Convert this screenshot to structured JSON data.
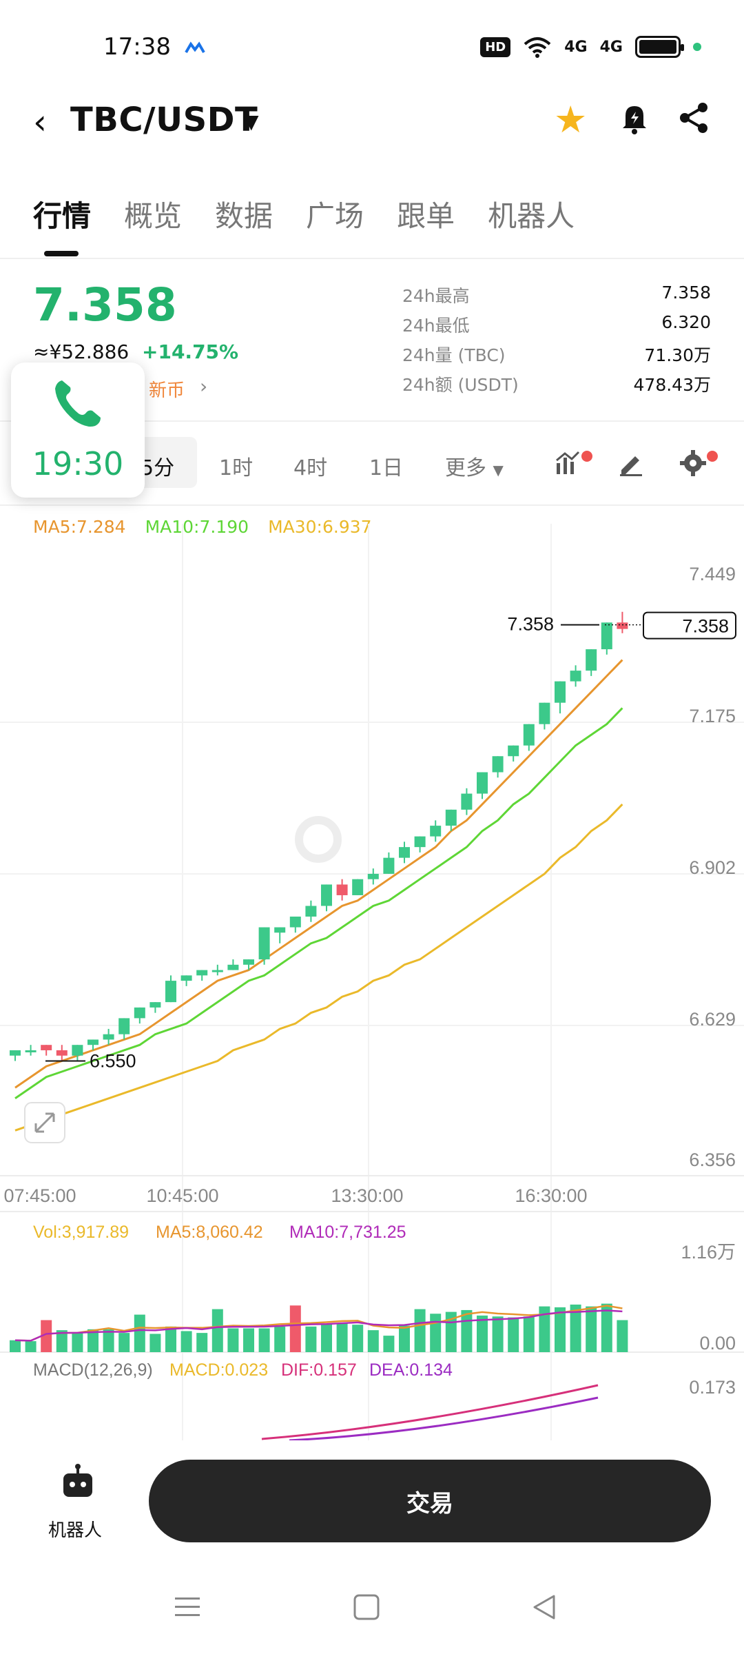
{
  "status_bar": {
    "time": "17:38",
    "hd": "HD",
    "signal_1": "4G",
    "signal_2": "4G"
  },
  "header": {
    "pair": "TBC/USDT"
  },
  "tabs": [
    "行情",
    "概览",
    "数据",
    "广场",
    "跟单",
    "机器人"
  ],
  "ticker": {
    "price": "7.358",
    "cny": "≈¥52.886",
    "change": "+14.75%",
    "tag": "新币",
    "stats": [
      {
        "label": "24h最高",
        "value": "7.358"
      },
      {
        "label": "24h最低",
        "value": "6.320"
      },
      {
        "label": "24h量 (TBC)",
        "value": "71.30万"
      },
      {
        "label": "24h额 (USDT)",
        "value": "478.43万"
      }
    ]
  },
  "call_overlay": {
    "time": "19:30"
  },
  "intervals": [
    "5分",
    "1时",
    "4时",
    "1日",
    "更多"
  ],
  "ma": {
    "ma5": "MA5:7.284",
    "ma10": "MA10:7.190",
    "ma30": "MA30:6.937"
  },
  "colors": {
    "up": "#23b26d",
    "candle_up": "#3cc98a",
    "candle_down": "#ef5a6a",
    "ma5": "#e7952e",
    "ma10": "#5ed636",
    "ma30": "#eab92a",
    "accent_star": "#f6b51e"
  },
  "chart_data": {
    "type": "candlestick",
    "price_axis_ticks": [
      "7.449",
      "7.175",
      "6.902",
      "6.629",
      "6.356"
    ],
    "ylim": [
      6.356,
      7.449
    ],
    "time_axis_ticks": [
      "07:45:00",
      "10:45:00",
      "13:30:00",
      "16:30:00"
    ],
    "last_price_label": "7.358",
    "last_price_tag": "7.358",
    "low_marker": "6.550",
    "candles": [
      {
        "o": 6.56,
        "h": 6.57,
        "l": 6.55,
        "c": 6.57
      },
      {
        "o": 6.57,
        "h": 6.58,
        "l": 6.56,
        "c": 6.57
      },
      {
        "o": 6.58,
        "h": 6.58,
        "l": 6.56,
        "c": 6.57
      },
      {
        "o": 6.57,
        "h": 6.58,
        "l": 6.55,
        "c": 6.56
      },
      {
        "o": 6.56,
        "h": 6.58,
        "l": 6.55,
        "c": 6.58
      },
      {
        "o": 6.58,
        "h": 6.59,
        "l": 6.57,
        "c": 6.59
      },
      {
        "o": 6.59,
        "h": 6.61,
        "l": 6.58,
        "c": 6.6
      },
      {
        "o": 6.6,
        "h": 6.63,
        "l": 6.59,
        "c": 6.63
      },
      {
        "o": 6.63,
        "h": 6.65,
        "l": 6.62,
        "c": 6.65
      },
      {
        "o": 6.65,
        "h": 6.66,
        "l": 6.64,
        "c": 6.66
      },
      {
        "o": 6.66,
        "h": 6.71,
        "l": 6.66,
        "c": 6.7
      },
      {
        "o": 6.7,
        "h": 6.71,
        "l": 6.69,
        "c": 6.71
      },
      {
        "o": 6.71,
        "h": 6.72,
        "l": 6.7,
        "c": 6.72
      },
      {
        "o": 6.72,
        "h": 6.73,
        "l": 6.71,
        "c": 6.72
      },
      {
        "o": 6.72,
        "h": 6.74,
        "l": 6.72,
        "c": 6.73
      },
      {
        "o": 6.73,
        "h": 6.74,
        "l": 6.72,
        "c": 6.74
      },
      {
        "o": 6.74,
        "h": 6.8,
        "l": 6.73,
        "c": 6.8
      },
      {
        "o": 6.79,
        "h": 6.8,
        "l": 6.77,
        "c": 6.8
      },
      {
        "o": 6.8,
        "h": 6.82,
        "l": 6.79,
        "c": 6.82
      },
      {
        "o": 6.82,
        "h": 6.85,
        "l": 6.81,
        "c": 6.84
      },
      {
        "o": 6.84,
        "h": 6.88,
        "l": 6.83,
        "c": 6.88
      },
      {
        "o": 6.88,
        "h": 6.89,
        "l": 6.85,
        "c": 6.86
      },
      {
        "o": 6.86,
        "h": 6.89,
        "l": 6.86,
        "c": 6.89
      },
      {
        "o": 6.89,
        "h": 6.91,
        "l": 6.88,
        "c": 6.9
      },
      {
        "o": 6.9,
        "h": 6.94,
        "l": 6.9,
        "c": 6.93
      },
      {
        "o": 6.93,
        "h": 6.96,
        "l": 6.92,
        "c": 6.95
      },
      {
        "o": 6.95,
        "h": 6.97,
        "l": 6.94,
        "c": 6.97
      },
      {
        "o": 6.97,
        "h": 7.0,
        "l": 6.96,
        "c": 6.99
      },
      {
        "o": 6.99,
        "h": 7.02,
        "l": 6.98,
        "c": 7.02
      },
      {
        "o": 7.02,
        "h": 7.06,
        "l": 7.01,
        "c": 7.05
      },
      {
        "o": 7.05,
        "h": 7.09,
        "l": 7.04,
        "c": 7.09
      },
      {
        "o": 7.09,
        "h": 7.12,
        "l": 7.08,
        "c": 7.12
      },
      {
        "o": 7.12,
        "h": 7.14,
        "l": 7.11,
        "c": 7.14
      },
      {
        "o": 7.14,
        "h": 7.18,
        "l": 7.13,
        "c": 7.18
      },
      {
        "o": 7.18,
        "h": 7.22,
        "l": 7.17,
        "c": 7.22
      },
      {
        "o": 7.22,
        "h": 7.26,
        "l": 7.2,
        "c": 7.26
      },
      {
        "o": 7.26,
        "h": 7.29,
        "l": 7.25,
        "c": 7.28
      },
      {
        "o": 7.28,
        "h": 7.32,
        "l": 7.27,
        "c": 7.32
      },
      {
        "o": 7.32,
        "h": 7.37,
        "l": 7.31,
        "c": 7.37
      },
      {
        "o": 7.37,
        "h": 7.39,
        "l": 7.35,
        "c": 7.358
      }
    ],
    "ma5_series": [
      6.5,
      6.52,
      6.54,
      6.55,
      6.56,
      6.57,
      6.58,
      6.59,
      6.6,
      6.62,
      6.64,
      6.66,
      6.68,
      6.7,
      6.71,
      6.72,
      6.74,
      6.76,
      6.78,
      6.8,
      6.82,
      6.84,
      6.85,
      6.87,
      6.89,
      6.91,
      6.93,
      6.95,
      6.98,
      7.0,
      7.03,
      7.06,
      7.09,
      7.12,
      7.15,
      7.18,
      7.21,
      7.24,
      7.27,
      7.3
    ],
    "ma10_series": [
      6.48,
      6.5,
      6.52,
      6.53,
      6.54,
      6.55,
      6.56,
      6.57,
      6.58,
      6.6,
      6.61,
      6.62,
      6.64,
      6.66,
      6.68,
      6.7,
      6.71,
      6.73,
      6.75,
      6.77,
      6.78,
      6.8,
      6.82,
      6.84,
      6.85,
      6.87,
      6.89,
      6.91,
      6.93,
      6.95,
      6.98,
      7.0,
      7.03,
      7.05,
      7.08,
      7.11,
      7.14,
      7.16,
      7.18,
      7.21
    ],
    "ma30_series": [
      6.42,
      6.43,
      6.44,
      6.45,
      6.46,
      6.47,
      6.48,
      6.49,
      6.5,
      6.51,
      6.52,
      6.53,
      6.54,
      6.55,
      6.57,
      6.58,
      6.59,
      6.61,
      6.62,
      6.64,
      6.65,
      6.67,
      6.68,
      6.7,
      6.71,
      6.73,
      6.74,
      6.76,
      6.78,
      6.8,
      6.82,
      6.84,
      6.86,
      6.88,
      6.9,
      6.93,
      6.95,
      6.98,
      7.0,
      7.03
    ],
    "volume": {
      "legend_vol": "Vol:3,917.89",
      "legend_ma5": "MA5:8,060.42",
      "legend_ma10": "MA10:7,731.25",
      "axis_top": "1.16万",
      "axis_bottom": "0.00",
      "ylim": [
        0,
        11600
      ],
      "values": [
        1300,
        1200,
        3500,
        2400,
        2200,
        2500,
        2500,
        2100,
        4100,
        2000,
        2800,
        2300,
        2100,
        4700,
        2600,
        2600,
        2600,
        2800,
        5100,
        2800,
        3100,
        3200,
        3000,
        2400,
        1800,
        2900,
        4700,
        4200,
        4400,
        4600,
        4000,
        3900,
        3800,
        3900,
        5000,
        4900,
        5200,
        5000,
        5300,
        3500
      ],
      "down_bars": [
        2,
        18
      ]
    },
    "macd": {
      "legend_label": "MACD(12,26,9)",
      "legend_macd": "MACD:0.023",
      "legend_dif": "DIF:0.157",
      "legend_dea": "DEA:0.134",
      "axis_top": "0.173"
    }
  },
  "bottom": {
    "robot_label": "机器人",
    "trade_label": "交易"
  }
}
